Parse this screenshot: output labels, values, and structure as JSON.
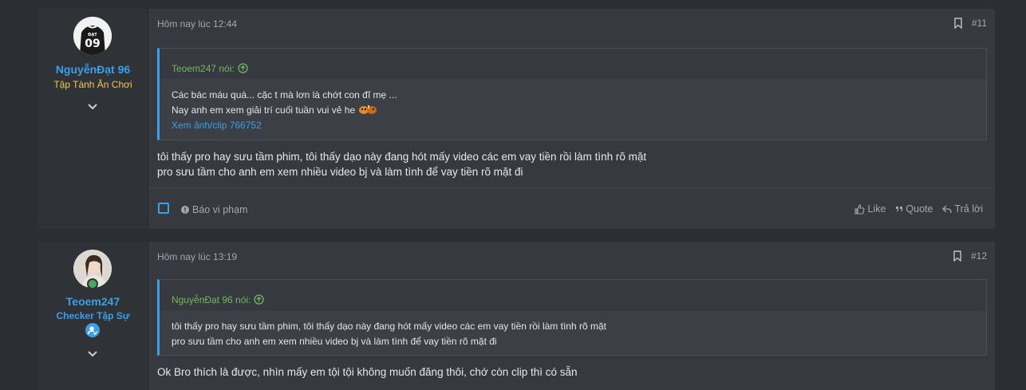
{
  "posts": [
    {
      "user": {
        "name": "NguyễnĐạt 96",
        "title": "Tập Tành Ăn Chơi",
        "avatar_text": "09",
        "avatar_name": "ĐẠT"
      },
      "date": "Hôm nay lúc 12:44",
      "number": "#11",
      "quote": {
        "author": "Teoem247 nói:",
        "lines": [
          "Các bác máu quá... cặc t mà lơn là chớt con đĩ mẹ ...",
          "Nay anh em xem giải trí cuối tuần vui vẻ he"
        ],
        "link": "Xem ảnh/clip 766752"
      },
      "message": [
        "tôi thấy pro hay sưu tầm phim, tôi thấy dạo này đang hót mấy video các em vay tiền rồi làm tình rõ mặt",
        "pro sưu tầm cho anh em xem nhiều video bj và làm tình để vay tiền rõ mặt đi"
      ],
      "footer": {
        "report": "Báo vi phạm",
        "like": "Like",
        "quote": "Quote",
        "reply": "Trả lời"
      }
    },
    {
      "user": {
        "name": "Teoem247",
        "title": "Checker Tập Sự"
      },
      "date": "Hôm nay lúc 13:19",
      "number": "#12",
      "quote": {
        "author": "NguyễnĐạt 96 nói:",
        "lines": [
          "tôi thấy pro hay sưu tầm phim, tôi thấy dạo này đang hót mấy video các em vay tiền rồi làm tình rõ mặt",
          "pro sưu tầm cho anh em xem nhiều video bj và làm tình để vay tiền rõ mặt đi"
        ]
      },
      "message": [
        "Ok Bro thích là được, nhìn mấy em tội tội không muốn đăng thôi, chớ còn clip thì có sẵn"
      ]
    }
  ],
  "colors": {
    "accent": "#3aa0e8",
    "quote_author": "#72b85a",
    "usertitle_gold": "#f2c94c"
  },
  "icons": [
    "bookmark-icon",
    "chevron-down-icon",
    "arrow-up-circle-icon",
    "info-icon",
    "thumbs-up-icon",
    "quote-icon",
    "reply-icon",
    "user-check-icon"
  ]
}
